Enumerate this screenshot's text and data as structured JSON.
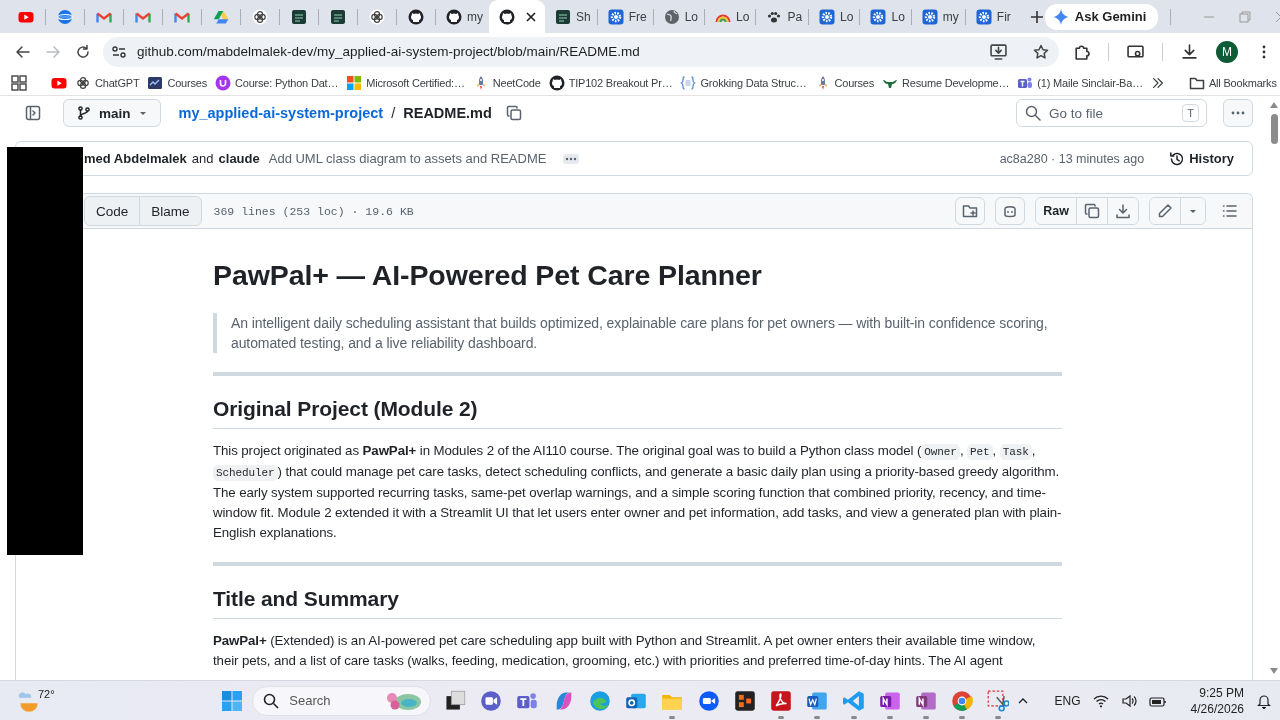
{
  "browser": {
    "tabs": [
      {
        "kind": "youtube",
        "selected": false
      },
      {
        "kind": "globe_app",
        "selected": false
      },
      {
        "kind": "mail",
        "selected": false
      },
      {
        "kind": "mail",
        "selected": false
      },
      {
        "kind": "mail",
        "selected": false
      },
      {
        "kind": "drive",
        "selected": false
      },
      {
        "kind": "knot",
        "selected": false
      },
      {
        "kind": "codepath",
        "selected": false
      },
      {
        "kind": "codepath",
        "selected": false
      },
      {
        "kind": "knot",
        "selected": false
      },
      {
        "kind": "github",
        "selected": false
      },
      {
        "kind": "github",
        "title": "my",
        "selected": false
      },
      {
        "kind": "github",
        "selected": true
      },
      {
        "kind": "codepath",
        "title": "Sh",
        "selected": false
      },
      {
        "kind": "gear",
        "title": "Fre",
        "selected": false
      },
      {
        "kind": "globe",
        "title": "Lo",
        "selected": false
      },
      {
        "kind": "rainbow",
        "title": "Lo",
        "selected": false
      },
      {
        "kind": "paw",
        "title": "Pa",
        "selected": false
      },
      {
        "kind": "gear",
        "title": "Lo",
        "selected": false
      },
      {
        "kind": "gear",
        "title": "Lo",
        "selected": false
      },
      {
        "kind": "gear",
        "title": "my",
        "selected": false
      },
      {
        "kind": "gear",
        "title": "Fir",
        "selected": false
      }
    ],
    "gemini_button": "Ask Gemini",
    "nav": {
      "back_disabled": false,
      "forward_disabled": true
    },
    "address": "github.com/mabdelmalek-dev/my_applied-ai-system-project/blob/main/README.md",
    "profile_initial": "M",
    "bookmarks": [
      {
        "kind": "youtube"
      },
      {
        "kind": "knot",
        "label": "ChatGPT"
      },
      {
        "kind": "courses",
        "label": "Courses"
      },
      {
        "kind": "udemy",
        "label": "Course: Python Dat…"
      },
      {
        "kind": "microsoft",
        "label": "Microsoft Certified:…"
      },
      {
        "kind": "rocket",
        "label": "NeetCode"
      },
      {
        "kind": "github",
        "label": "TIP102 Breakout Pr…"
      },
      {
        "kind": "braces",
        "label": "Grokking Data Struc…"
      },
      {
        "kind": "rocket",
        "label": "Courses"
      },
      {
        "kind": "horns",
        "label": "Resume Developme…"
      },
      {
        "kind": "teams",
        "label": "(1) Maile Sinclair-Ba…"
      }
    ],
    "all_bookmarks": "All Bookmarks"
  },
  "repo": {
    "branch": "main",
    "repo_link": "my_applied-ai-system-project",
    "separator": "/",
    "file_name": "README.md",
    "search": {
      "placeholder": "Go to file",
      "shortcut": "T"
    },
    "commit": {
      "author": "med Abdelmalek",
      "joiner": "and",
      "coauthor": "claude",
      "message": "Add UML class diagram to assets and README",
      "meta": "ac8a280 · 13 minutes ago",
      "history": "History"
    },
    "file_header": {
      "views": [
        {
          "label": "Code",
          "selected": false
        },
        {
          "label": "Blame",
          "selected": false
        }
      ],
      "stats": "369 lines (253 loc) · 19.6 KB",
      "raw": "Raw"
    }
  },
  "readme": {
    "blocks": [
      {
        "kind": "h1",
        "text": "PawPal+ — AI-Powered Pet Care Planner"
      },
      {
        "kind": "quote",
        "text": "An intelligent daily scheduling assistant that builds optimized, explainable care plans for pet owners — with built-in confidence scoring, automated testing, and a live reliability dashboard."
      },
      {
        "kind": "rule"
      },
      {
        "kind": "h2",
        "text": "Original Project (Module 2)"
      },
      {
        "kind": "paragraph",
        "parts": [
          {
            "kind": "text",
            "text": "This project originated as **PawPal+** in Modules 2 of the AI110 course. The original goal was to build a Python class model ("
          },
          {
            "kind": "code",
            "text": "Owner"
          },
          {
            "kind": "text",
            "text": ", "
          },
          {
            "kind": "code",
            "text": "Pet"
          },
          {
            "kind": "text",
            "text": ", "
          },
          {
            "kind": "code",
            "text": "Task"
          },
          {
            "kind": "text",
            "text": ", "
          },
          {
            "kind": "code",
            "text": "Scheduler"
          },
          {
            "kind": "text",
            "text": ") that could manage pet care tasks, detect scheduling conflicts, and generate a basic daily plan using a priority-based greedy algorithm. The early system supported recurring tasks, same-pet overlap warnings, and a simple scoring function that combined priority, recency, and time-window fit. Module 2 extended it with a Streamlit UI that let users enter owner and pet information, add tasks, and view a generated plan with plain-English explanations."
          }
        ]
      },
      {
        "kind": "rule"
      },
      {
        "kind": "h2",
        "text": "Title and Summary"
      },
      {
        "kind": "paragraph",
        "parts": [
          {
            "kind": "text",
            "text": "**PawPal+** (Extended) is an AI-powered pet care scheduling app built with Python and Streamlit. A pet owner enters their available time window, their pets, and a list of care tasks (walks, feeding, medication, grooming, etc.) with priorities and preferred time-of-day hints. The AI agent"
          }
        ]
      }
    ]
  },
  "taskbar": {
    "weather": "72°",
    "search_placeholder": "Search",
    "apps": [
      {
        "kind": "taskview",
        "running": false
      },
      {
        "kind": "meet",
        "running": false
      },
      {
        "kind": "teams",
        "running": false
      },
      {
        "kind": "copilot",
        "running": false
      },
      {
        "kind": "edge",
        "running": false
      },
      {
        "kind": "outlook",
        "running": false
      },
      {
        "kind": "explorer",
        "running": true
      },
      {
        "kind": "zoom",
        "running": false
      },
      {
        "kind": "blocks",
        "running": false
      },
      {
        "kind": "acrobat",
        "running": true
      },
      {
        "kind": "word",
        "running": true
      },
      {
        "kind": "vscode",
        "running": true
      },
      {
        "kind": "onenote",
        "running": true
      },
      {
        "kind": "onenote2",
        "running": true
      },
      {
        "kind": "chrome",
        "running": true
      },
      {
        "kind": "snip",
        "running": true
      }
    ],
    "language": "ENG",
    "time": "9:25 PM",
    "date": "4/26/2026"
  }
}
